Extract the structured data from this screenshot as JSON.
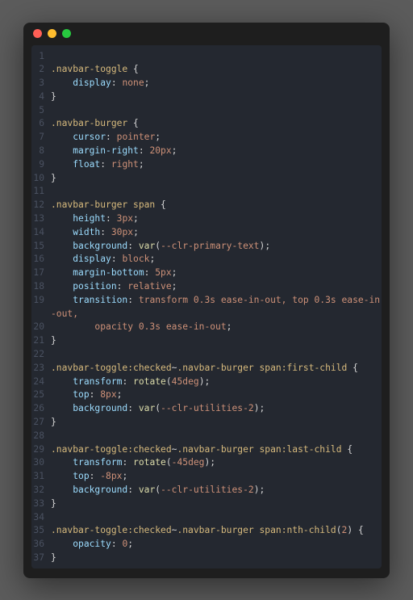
{
  "window": {
    "controls": [
      "close",
      "minimize",
      "zoom"
    ]
  },
  "code": {
    "lines": [
      {
        "n": 1,
        "tokens": []
      },
      {
        "n": 2,
        "tokens": [
          {
            "t": ".navbar-toggle",
            "c": "sel"
          },
          {
            "t": " {",
            "c": "punc"
          }
        ]
      },
      {
        "n": 3,
        "tokens": [
          {
            "t": "    ",
            "c": "punc"
          },
          {
            "t": "display",
            "c": "prop"
          },
          {
            "t": ": ",
            "c": "punc"
          },
          {
            "t": "none",
            "c": "val"
          },
          {
            "t": ";",
            "c": "punc"
          }
        ]
      },
      {
        "n": 4,
        "tokens": [
          {
            "t": "}",
            "c": "punc"
          }
        ]
      },
      {
        "n": 5,
        "tokens": []
      },
      {
        "n": 6,
        "tokens": [
          {
            "t": ".navbar-burger",
            "c": "sel"
          },
          {
            "t": " {",
            "c": "punc"
          }
        ]
      },
      {
        "n": 7,
        "tokens": [
          {
            "t": "    ",
            "c": "punc"
          },
          {
            "t": "cursor",
            "c": "prop"
          },
          {
            "t": ": ",
            "c": "punc"
          },
          {
            "t": "pointer",
            "c": "val"
          },
          {
            "t": ";",
            "c": "punc"
          }
        ]
      },
      {
        "n": 8,
        "tokens": [
          {
            "t": "    ",
            "c": "punc"
          },
          {
            "t": "margin-right",
            "c": "prop"
          },
          {
            "t": ": ",
            "c": "punc"
          },
          {
            "t": "20px",
            "c": "val"
          },
          {
            "t": ";",
            "c": "punc"
          }
        ]
      },
      {
        "n": 9,
        "tokens": [
          {
            "t": "    ",
            "c": "punc"
          },
          {
            "t": "float",
            "c": "prop"
          },
          {
            "t": ": ",
            "c": "punc"
          },
          {
            "t": "right",
            "c": "val"
          },
          {
            "t": ";",
            "c": "punc"
          }
        ]
      },
      {
        "n": 10,
        "tokens": [
          {
            "t": "}",
            "c": "punc"
          }
        ]
      },
      {
        "n": 11,
        "tokens": []
      },
      {
        "n": 12,
        "tokens": [
          {
            "t": ".navbar-burger",
            "c": "sel"
          },
          {
            "t": " ",
            "c": "punc"
          },
          {
            "t": "span",
            "c": "sel"
          },
          {
            "t": " {",
            "c": "punc"
          }
        ]
      },
      {
        "n": 13,
        "tokens": [
          {
            "t": "    ",
            "c": "punc"
          },
          {
            "t": "height",
            "c": "prop"
          },
          {
            "t": ": ",
            "c": "punc"
          },
          {
            "t": "3px",
            "c": "val"
          },
          {
            "t": ";",
            "c": "punc"
          }
        ]
      },
      {
        "n": 14,
        "tokens": [
          {
            "t": "    ",
            "c": "punc"
          },
          {
            "t": "width",
            "c": "prop"
          },
          {
            "t": ": ",
            "c": "punc"
          },
          {
            "t": "30px",
            "c": "val"
          },
          {
            "t": ";",
            "c": "punc"
          }
        ]
      },
      {
        "n": 15,
        "tokens": [
          {
            "t": "    ",
            "c": "punc"
          },
          {
            "t": "background",
            "c": "prop"
          },
          {
            "t": ": ",
            "c": "punc"
          },
          {
            "t": "var",
            "c": "func"
          },
          {
            "t": "(",
            "c": "punc"
          },
          {
            "t": "--clr-primary-text",
            "c": "val"
          },
          {
            "t": ")",
            "c": "punc"
          },
          {
            "t": ";",
            "c": "punc"
          }
        ]
      },
      {
        "n": 16,
        "tokens": [
          {
            "t": "    ",
            "c": "punc"
          },
          {
            "t": "display",
            "c": "prop"
          },
          {
            "t": ": ",
            "c": "punc"
          },
          {
            "t": "block",
            "c": "val"
          },
          {
            "t": ";",
            "c": "punc"
          }
        ]
      },
      {
        "n": 17,
        "tokens": [
          {
            "t": "    ",
            "c": "punc"
          },
          {
            "t": "margin-bottom",
            "c": "prop"
          },
          {
            "t": ": ",
            "c": "punc"
          },
          {
            "t": "5px",
            "c": "val"
          },
          {
            "t": ";",
            "c": "punc"
          }
        ]
      },
      {
        "n": 18,
        "tokens": [
          {
            "t": "    ",
            "c": "punc"
          },
          {
            "t": "position",
            "c": "prop"
          },
          {
            "t": ": ",
            "c": "punc"
          },
          {
            "t": "relative",
            "c": "val"
          },
          {
            "t": ";",
            "c": "punc"
          }
        ]
      },
      {
        "n": 19,
        "tokens": [
          {
            "t": "    ",
            "c": "punc"
          },
          {
            "t": "transition",
            "c": "prop"
          },
          {
            "t": ": ",
            "c": "punc"
          },
          {
            "t": "transform 0.3s ease-in-out, top 0.3s ease-in-out,",
            "c": "val"
          }
        ]
      },
      {
        "n": 20,
        "tokens": [
          {
            "t": "        ",
            "c": "punc"
          },
          {
            "t": "opacity 0.3s ease-in-out",
            "c": "val"
          },
          {
            "t": ";",
            "c": "punc"
          }
        ]
      },
      {
        "n": 21,
        "tokens": [
          {
            "t": "}",
            "c": "punc"
          }
        ]
      },
      {
        "n": 22,
        "tokens": []
      },
      {
        "n": 23,
        "tokens": [
          {
            "t": ".navbar-toggle:checked",
            "c": "sel"
          },
          {
            "t": "~",
            "c": "punc"
          },
          {
            "t": ".navbar-burger",
            "c": "sel"
          },
          {
            "t": " ",
            "c": "punc"
          },
          {
            "t": "span:first-child",
            "c": "sel"
          },
          {
            "t": " {",
            "c": "punc"
          }
        ]
      },
      {
        "n": 24,
        "tokens": [
          {
            "t": "    ",
            "c": "punc"
          },
          {
            "t": "transform",
            "c": "prop"
          },
          {
            "t": ": ",
            "c": "punc"
          },
          {
            "t": "rotate",
            "c": "func"
          },
          {
            "t": "(",
            "c": "punc"
          },
          {
            "t": "45deg",
            "c": "val"
          },
          {
            "t": ")",
            "c": "punc"
          },
          {
            "t": ";",
            "c": "punc"
          }
        ]
      },
      {
        "n": 25,
        "tokens": [
          {
            "t": "    ",
            "c": "punc"
          },
          {
            "t": "top",
            "c": "prop"
          },
          {
            "t": ": ",
            "c": "punc"
          },
          {
            "t": "8px",
            "c": "val"
          },
          {
            "t": ";",
            "c": "punc"
          }
        ]
      },
      {
        "n": 26,
        "tokens": [
          {
            "t": "    ",
            "c": "punc"
          },
          {
            "t": "background",
            "c": "prop"
          },
          {
            "t": ": ",
            "c": "punc"
          },
          {
            "t": "var",
            "c": "func"
          },
          {
            "t": "(",
            "c": "punc"
          },
          {
            "t": "--clr-utilities-2",
            "c": "val"
          },
          {
            "t": ")",
            "c": "punc"
          },
          {
            "t": ";",
            "c": "punc"
          }
        ]
      },
      {
        "n": 27,
        "tokens": [
          {
            "t": "}",
            "c": "punc"
          }
        ]
      },
      {
        "n": 28,
        "tokens": []
      },
      {
        "n": 29,
        "tokens": [
          {
            "t": ".navbar-toggle:checked",
            "c": "sel"
          },
          {
            "t": "~",
            "c": "punc"
          },
          {
            "t": ".navbar-burger",
            "c": "sel"
          },
          {
            "t": " ",
            "c": "punc"
          },
          {
            "t": "span:last-child",
            "c": "sel"
          },
          {
            "t": " {",
            "c": "punc"
          }
        ]
      },
      {
        "n": 30,
        "tokens": [
          {
            "t": "    ",
            "c": "punc"
          },
          {
            "t": "transform",
            "c": "prop"
          },
          {
            "t": ": ",
            "c": "punc"
          },
          {
            "t": "rotate",
            "c": "func"
          },
          {
            "t": "(",
            "c": "punc"
          },
          {
            "t": "-45deg",
            "c": "val"
          },
          {
            "t": ")",
            "c": "punc"
          },
          {
            "t": ";",
            "c": "punc"
          }
        ]
      },
      {
        "n": 31,
        "tokens": [
          {
            "t": "    ",
            "c": "punc"
          },
          {
            "t": "top",
            "c": "prop"
          },
          {
            "t": ": ",
            "c": "punc"
          },
          {
            "t": "-8px",
            "c": "val"
          },
          {
            "t": ";",
            "c": "punc"
          }
        ]
      },
      {
        "n": 32,
        "tokens": [
          {
            "t": "    ",
            "c": "punc"
          },
          {
            "t": "background",
            "c": "prop"
          },
          {
            "t": ": ",
            "c": "punc"
          },
          {
            "t": "var",
            "c": "func"
          },
          {
            "t": "(",
            "c": "punc"
          },
          {
            "t": "--clr-utilities-2",
            "c": "val"
          },
          {
            "t": ")",
            "c": "punc"
          },
          {
            "t": ";",
            "c": "punc"
          }
        ]
      },
      {
        "n": 33,
        "tokens": [
          {
            "t": "}",
            "c": "punc"
          }
        ]
      },
      {
        "n": 34,
        "tokens": []
      },
      {
        "n": 35,
        "tokens": [
          {
            "t": ".navbar-toggle:checked",
            "c": "sel"
          },
          {
            "t": "~",
            "c": "punc"
          },
          {
            "t": ".navbar-burger",
            "c": "sel"
          },
          {
            "t": " ",
            "c": "punc"
          },
          {
            "t": "span:nth-child",
            "c": "sel"
          },
          {
            "t": "(",
            "c": "punc"
          },
          {
            "t": "2",
            "c": "val"
          },
          {
            "t": ")",
            "c": "punc"
          },
          {
            "t": " {",
            "c": "punc"
          }
        ]
      },
      {
        "n": 36,
        "tokens": [
          {
            "t": "    ",
            "c": "punc"
          },
          {
            "t": "opacity",
            "c": "prop"
          },
          {
            "t": ": ",
            "c": "punc"
          },
          {
            "t": "0",
            "c": "val"
          },
          {
            "t": ";",
            "c": "punc"
          }
        ]
      },
      {
        "n": 37,
        "tokens": [
          {
            "t": "}",
            "c": "punc"
          }
        ]
      }
    ]
  }
}
